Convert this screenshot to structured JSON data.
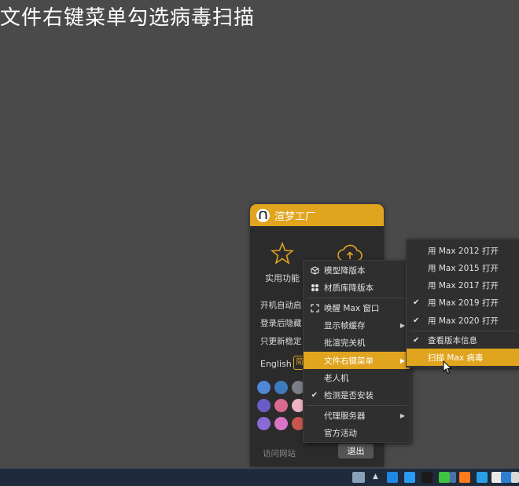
{
  "page_title": "文件右键菜单勾选病毒扫描",
  "app": {
    "title": "渲梦工厂",
    "features": [
      {
        "label": "实用功能",
        "icon": "star-icon"
      },
      {
        "label": "",
        "icon": "cloud-upload-icon"
      }
    ],
    "options": [
      "开机自动启",
      "登录后隐藏",
      "只更新稳定"
    ],
    "language_label": "English",
    "language_box": "简",
    "swatch_colors": [
      "#4f86d6",
      "#3d7bbf",
      "#7a7f87",
      "#6a5cc4",
      "#d96a8f",
      "#f0b3c4",
      "#8a6ad6",
      "#d975c7",
      "#c9574f"
    ],
    "visit_label": "访问网站",
    "exit_label": "退出",
    "accent": "#e0a41e"
  },
  "context_menu": {
    "items": [
      {
        "label": "模型降版本",
        "icon": "cube-icon"
      },
      {
        "label": "材质库降版本",
        "icon": "grid-dots-icon"
      },
      {
        "label": "唤醒 Max 窗口",
        "icon": "expand-icon"
      },
      {
        "label": "显示帧缓存",
        "arrow": "▶"
      },
      {
        "label": "批渲完关机"
      },
      {
        "label": "文件右键菜单",
        "arrow": "▶",
        "active": true
      },
      {
        "label": "老人机"
      },
      {
        "label": "检测是否安装",
        "check": "✔"
      },
      {
        "label": "代理服务器",
        "arrow": "▶"
      },
      {
        "label": "官方活动"
      }
    ]
  },
  "sub_menu": {
    "items": [
      {
        "label": "用 Max 2012 打开"
      },
      {
        "label": "用 Max 2015 打开"
      },
      {
        "label": "用 Max 2017 打开"
      },
      {
        "label": "用 Max 2019 打开",
        "check": "✔"
      },
      {
        "label": "用 Max 2020 打开",
        "check": "✔"
      },
      {
        "label": "查看版本信息",
        "check": "✔"
      },
      {
        "label": "扫描 Max 病毒",
        "active": true
      }
    ]
  },
  "taskbar": {
    "arrow": "▲",
    "tray_colors": [
      "#8aa0b8",
      "#1e88e5",
      "#2b9af3",
      "#1a1a1a",
      "#3ec43e",
      "#4d6fa8",
      "#ff7a1a",
      "#29a0e6",
      "#e8e8e8",
      "#2d7fd3",
      "#d9d9d9"
    ]
  }
}
